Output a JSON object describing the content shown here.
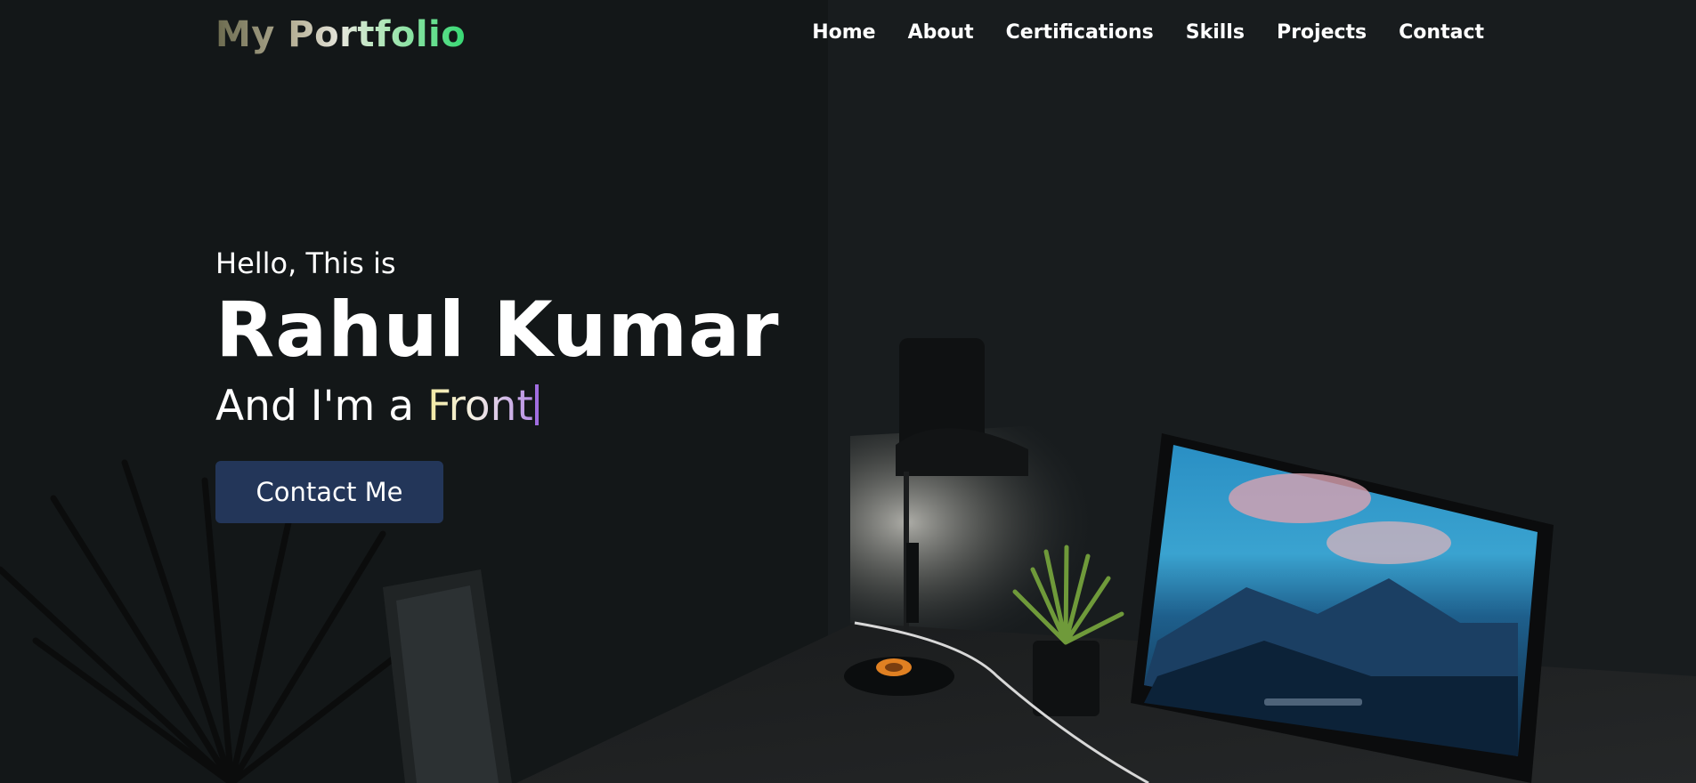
{
  "brand": {
    "logo": "My Portfolio"
  },
  "nav": {
    "items": [
      {
        "label": "Home"
      },
      {
        "label": "About"
      },
      {
        "label": "Certifications"
      },
      {
        "label": "Skills"
      },
      {
        "label": "Projects"
      },
      {
        "label": "Contact"
      }
    ]
  },
  "hero": {
    "greeting": "Hello, This is",
    "name": "Rahul Kumar",
    "tagline_prefix": "And I'm a ",
    "typed_text": "Front",
    "button_label": "Contact Me"
  },
  "background": {
    "description_icon": "desk-setup-photo",
    "colors": {
      "base": "#131718",
      "button": "#233659",
      "cursor": "#a06de0"
    }
  }
}
